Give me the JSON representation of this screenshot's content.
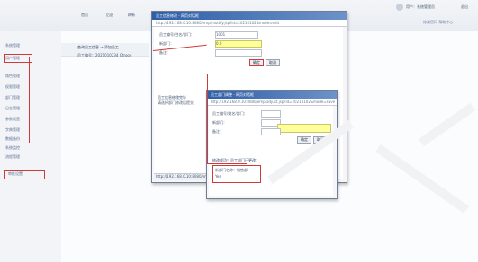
{
  "topbar": {
    "nav": [
      "首页",
      "后退",
      "刷新"
    ],
    "user_text": "用户：系统管理员",
    "action_text": "退出",
    "sub_text": "修改密码 帮助中心"
  },
  "sidebar": {
    "items": [
      "系统管理",
      "用户管理",
      "角色管理",
      "权限管理",
      "部门管理",
      "日志管理",
      "参数设置",
      "字典管理",
      "数据备份",
      "系统监控",
      "流程管理",
      "审批设置"
    ]
  },
  "list": {
    "header": "查询员工信息 → 添加员工",
    "row": "员工编号：2021010234 Gtroon"
  },
  "window1": {
    "title": "员工信息修改 - 网页对话框",
    "address": "http://192.168.0.10:8080/emp/modify.jsp?id=20210102&mode=edit",
    "labels": [
      "员工编号/姓名/部门：",
      "新部门：",
      "备注："
    ],
    "values": [
      "1001",
      "0.0",
      ""
    ],
    "button_ok": "确定",
    "button_cancel": "取消",
    "note_title": "员工信息修改完毕",
    "note_text": "请选择部门修改后提交"
  },
  "window2": {
    "title": "员工部门调整 - 网页对话框",
    "address": "http://192.168.0.10:8080/emp/adjust.jsp?id=20210102&mode=save",
    "labels": [
      "员工编号/姓名/部门：",
      "新部门：",
      "备注："
    ],
    "values": [
      "",
      "",
      ""
    ],
    "button_ok": "确定",
    "button_cancel": "取消",
    "result_title": "修改成功！员工部门已更改：",
    "result_line1": "新部门名称：销售部",
    "result_line2": "Yes"
  },
  "statusbar": {
    "text": "http://192.168.0.10:8080/emp/list.jsp"
  },
  "colors": {
    "accent": "#d23a3a",
    "title": "#2f5fa7",
    "highlight": "#ffff99"
  }
}
